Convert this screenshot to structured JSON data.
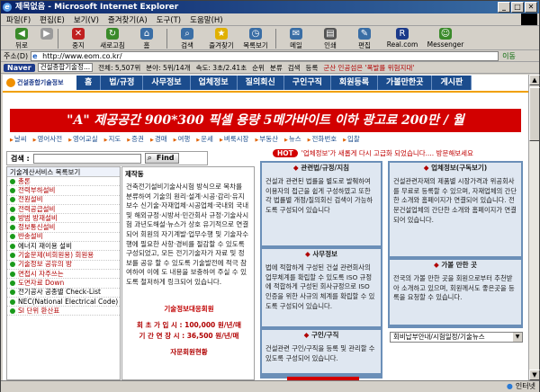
{
  "window": {
    "title": "제목없음 - Microsoft Internet Explorer",
    "controls": [
      "_",
      "□",
      "✕"
    ]
  },
  "menu": [
    "파일(F)",
    "편집(E)",
    "보기(V)",
    "즐겨찾기(A)",
    "도구(T)",
    "도움말(H)"
  ],
  "toolbar": [
    {
      "label": "뒤로",
      "icon": "back-icon",
      "color": "#3a8a2a"
    },
    {
      "label": "",
      "icon": "forward-icon",
      "color": "#9a9a9a"
    },
    {
      "label": "중지",
      "icon": "stop-icon",
      "color": "#c02020"
    },
    {
      "label": "새로고침",
      "icon": "refresh-icon",
      "color": "#3a8a2a"
    },
    {
      "label": "홈",
      "icon": "home-icon",
      "color": "#3a6ea5"
    },
    {
      "label": "검색",
      "icon": "search-icon",
      "color": "#3a6ea5"
    },
    {
      "label": "즐겨찾기",
      "icon": "favorites-icon",
      "color": "#e0b000"
    },
    {
      "label": "목록보기",
      "icon": "history-icon",
      "color": "#3a6ea5"
    },
    {
      "label": "메일",
      "icon": "mail-icon",
      "color": "#3a6ea5"
    },
    {
      "label": "인쇄",
      "icon": "print-icon",
      "color": "#555555"
    },
    {
      "label": "편집",
      "icon": "edit-icon",
      "color": "#3a6ea5"
    },
    {
      "label": "Real.com",
      "icon": "real-icon",
      "color": "#1c3a8a"
    },
    {
      "label": "Messenger",
      "icon": "messenger-icon",
      "color": "#3a8a2a"
    }
  ],
  "address": {
    "label": "주소(D)",
    "url": "http://www.eom.co.kr/",
    "go": "이동"
  },
  "navbar": {
    "logo": "Naver",
    "site": "건설종합기술정...",
    "items": [
      "전체: 5,507위",
      "분야: 5위/14개",
      "속도: 3초/2.41초",
      "순위",
      "분류",
      "검색",
      "등록"
    ],
    "news": "군산 인공섬은 '폭발를 위험지대'"
  },
  "site": {
    "logo": "건설종합기술정보",
    "gnb": [
      "홈",
      "법/규정",
      "사무정보",
      "업체정보",
      "질의회신",
      "구인구직",
      "회원등록",
      "가볼만한곳",
      "게시판"
    ],
    "banner": "\"A\" 제공공간 900*300 픽셀 용량 5메가바이트 이하 광고료 200만 / 월",
    "quicklinks": [
      "날씨",
      "영어사전",
      "영어교실",
      "지도",
      "증권",
      "경매",
      "여행",
      "운세",
      "벼룩시장",
      "부동산",
      "뉴스",
      "전화번호",
      "입찰"
    ],
    "hot": {
      "tag": "HOT",
      "text": "'업체정보'가 새롭게 다시 고급화 되었습니다.... 방문해보세요"
    },
    "search": {
      "label": "검색 :",
      "button": "Find"
    },
    "left_head": "기술계산서비스 목록보기",
    "left_items": [
      {
        "label": "총론",
        "style": "r"
      },
      {
        "label": "전력부하설비",
        "style": "r"
      },
      {
        "label": "전원설비",
        "style": "r"
      },
      {
        "label": "전력공급설비",
        "style": "r"
      },
      {
        "label": "방범 방재설비",
        "style": "r"
      },
      {
        "label": "정보통신설비",
        "style": "r"
      },
      {
        "label": "반송설비",
        "style": "r"
      },
      {
        "label": "에너지 재이용 설비",
        "style": "g"
      },
      {
        "label": "기술문제(비회원용) 회원용",
        "style": "r"
      },
      {
        "label": "기술정보 공유의 방",
        "style": "r"
      },
      {
        "label": "면접시 자주쓰는",
        "style": "r"
      },
      {
        "label": "도면자료 Down",
        "style": "r"
      },
      {
        "label": "전기공사 공종별 Check-List",
        "style": "g"
      },
      {
        "label": "NEC(National Electrical Code)",
        "style": "g"
      },
      {
        "label": "SI 단위 환산표",
        "style": "r"
      }
    ],
    "mid": {
      "title": "제작동",
      "text": "건축전기설비기술사시험 방식으로 목차를 분류하여 기술의 원리·설계·시공·감리·유지보수 신기술·자재업체·시공업체·국내외 국내 및 해외규정·시방서·민간회사 규정·기술사시험 과년도해설·뉴스가 상호 유기적으로 연결되어 회원의 자기계발·업무수행 및 기술자수행에 필요한 사항·경비를 절감할 수 있도록 구성되었고, 모든 전기기술자가 자료 및 정보를 공유 할 수 있도록 기술발전에 적극 참여하여 이에 도 내용을 보충하여 주실 수 있도록 철저하게 링크되어 있습니다.",
      "stats_title": "기술정보대응회원",
      "stats_line1": "회 초 가 입 시 : 100,000 원/년/매",
      "stats_line2": "기 간 연 장 시 : 36,500 원/년/매",
      "stats_footer": "자문회원현황"
    },
    "cards_left": [
      {
        "title": "관련법/규정/지침",
        "text": "건설과 관련된 법률을 별도로 발췌하여 이용자의 접근을 쉽게 구성하였고 또한 각 법률별 개정/질의회신 검색이 가능하도록 구성되어 있습니다"
      },
      {
        "title": "사무정보",
        "text": "법에 적합하게 구성된 건설 관련회사의 업무체계를 확립할 수 있도록 ISO 규정에 적합하게 구성된 회사규정으로 ISO 인증을 위한 사규의 체계를 확립할 수 있도록 구성되어 있습니다."
      },
      {
        "title": "구인/구직",
        "text": "건설관련 구인/구직을 등록 및 관리할 수 있도록 구성되어 있습니다."
      }
    ],
    "cards_right": [
      {
        "title": "업체정보(구독보기)",
        "text": "건설관련자재의 제품별 시장가격과 위공회사를 무료로 등록할 수 있으며, 자재업체의 간단한 소개와 홈페이지가 연결되어 있습니다. 전문건설업체의 간단한 소개와 홈페이지가 연결되어 있습니다."
      },
      {
        "title": "가볼 만한 곳",
        "text": "전국의 가볼 만한 곳을 회원으로부터 추천받아 소개하고 있으며, 회원께서도 좋은곳을 등록을 요청할 수 있습니다."
      }
    ],
    "dropdown": "회비납부안내/시험일정/기술뉴스"
  },
  "status": {
    "left": "",
    "zone": "인터넷"
  }
}
